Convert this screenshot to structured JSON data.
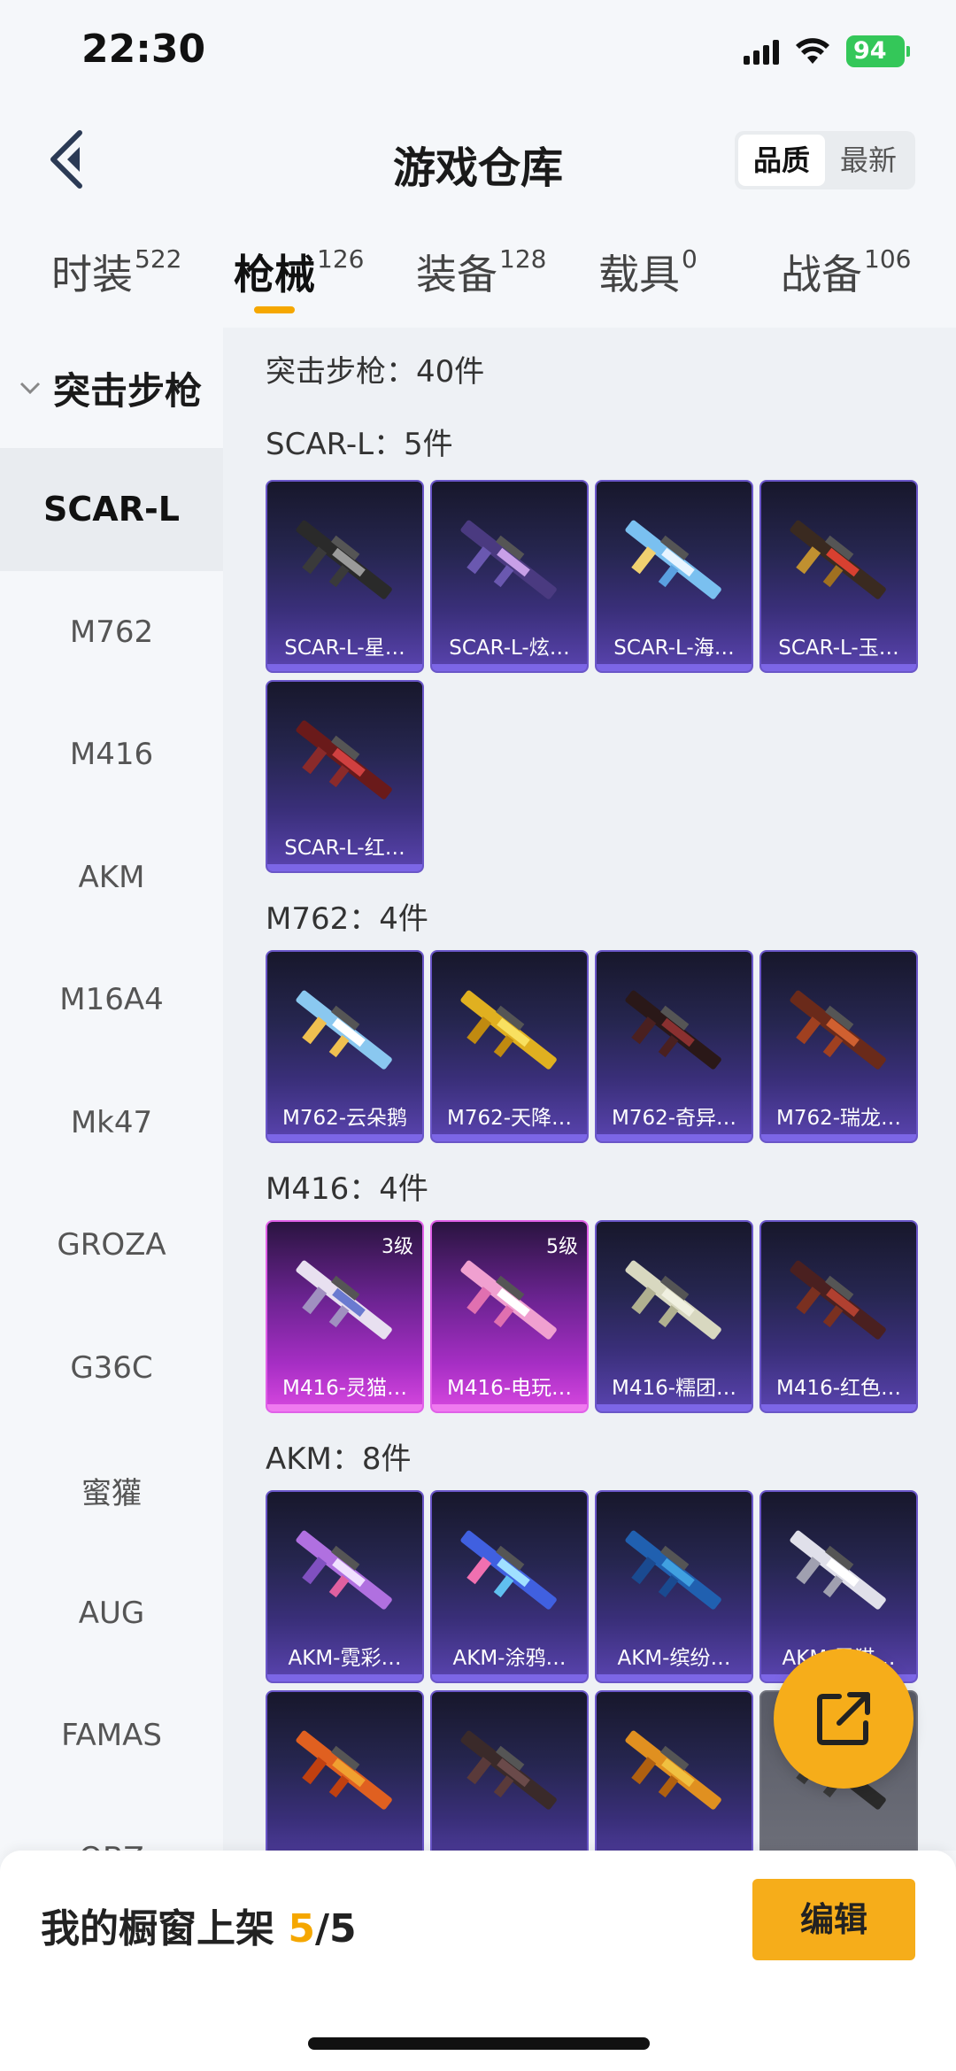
{
  "status": {
    "time": "22:30",
    "battery": "94"
  },
  "header": {
    "title": "游戏仓库",
    "sort_options": [
      "品质",
      "最新"
    ]
  },
  "tabs": [
    {
      "label": "时装",
      "count": "522"
    },
    {
      "label": "枪械",
      "count": "126"
    },
    {
      "label": "装备",
      "count": "128"
    },
    {
      "label": "载具",
      "count": "0"
    },
    {
      "label": "战备",
      "count": "106"
    }
  ],
  "sidebar": {
    "category": "突击步枪",
    "items": [
      "SCAR-L",
      "M762",
      "M416",
      "AKM",
      "M16A4",
      "Mk47",
      "GROZA",
      "G36C",
      "蜜獾",
      "AUG",
      "FAMAS",
      "QBZ"
    ]
  },
  "content": {
    "total": "突击步枪：40件",
    "groups": [
      {
        "title": "SCAR-L：5件",
        "items": [
          "SCAR-L-星…",
          "SCAR-L-炫…",
          "SCAR-L-海…",
          "SCAR-L-玉…",
          "SCAR-L-红…"
        ]
      },
      {
        "title": "M762：4件",
        "items": [
          "M762-云朵鹅",
          "M762-天降…",
          "M762-奇异…",
          "M762-瑞龙…"
        ]
      },
      {
        "title": "M416：4件",
        "items": [
          "M416-灵猫…",
          "M416-电玩…",
          "M416-糯团…",
          "M416-红色…"
        ],
        "levels": [
          "3级",
          "5级",
          "",
          ""
        ]
      },
      {
        "title": "AKM：8件",
        "items": [
          "AKM-霓彩…",
          "AKM-涂鸦…",
          "AKM-缤纷…",
          "AKM-灵猫…"
        ]
      }
    ]
  },
  "bottom": {
    "showcase_label": "我的橱窗上架",
    "showcase_current": "5",
    "showcase_total": "/5",
    "edit_label": "编辑"
  },
  "colors": {
    "accent": "#f6ad1a",
    "card_purple": "#5a44b0",
    "card_pink": "#d848e0"
  }
}
